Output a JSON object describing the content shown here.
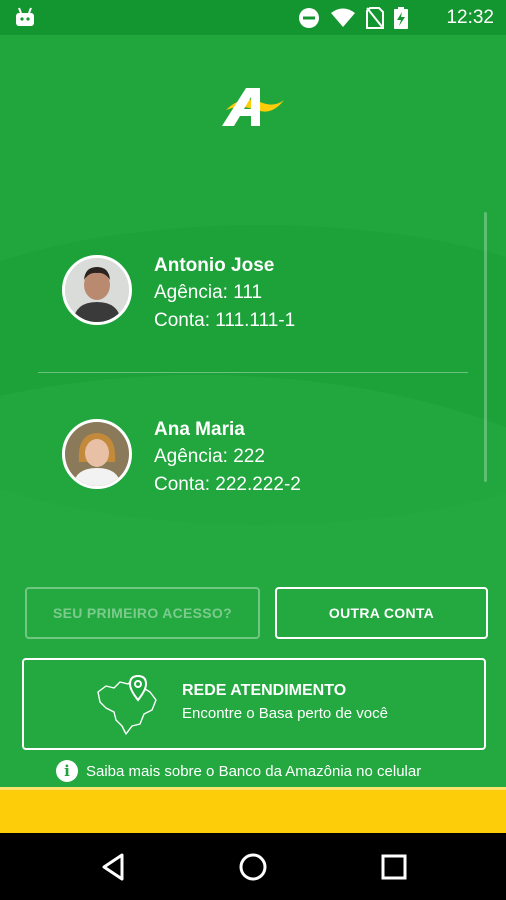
{
  "status_bar": {
    "time": "12:32",
    "icons": [
      "android-icon",
      "do-not-disturb-icon",
      "wifi-icon",
      "no-sim-icon",
      "battery-charging-icon"
    ]
  },
  "accounts": [
    {
      "name": "Antonio Jose",
      "agencia": "Agência: 111",
      "conta": "Conta: 111.111-1"
    },
    {
      "name": "Ana Maria",
      "agencia": "Agência: 222",
      "conta": "Conta: 222.222-2"
    }
  ],
  "buttons": {
    "first_access": "SEU PRIMEIRO ACESSO?",
    "other_account": "OUTRA CONTA"
  },
  "network": {
    "title": "REDE ATENDIMENTO",
    "subtitle": "Encontre o Basa perto de você"
  },
  "info_link": "Saiba mais sobre o Banco da Amazônia no celular",
  "colors": {
    "primary_green": "#21a63d",
    "accent_yellow": "#fecd0a"
  }
}
